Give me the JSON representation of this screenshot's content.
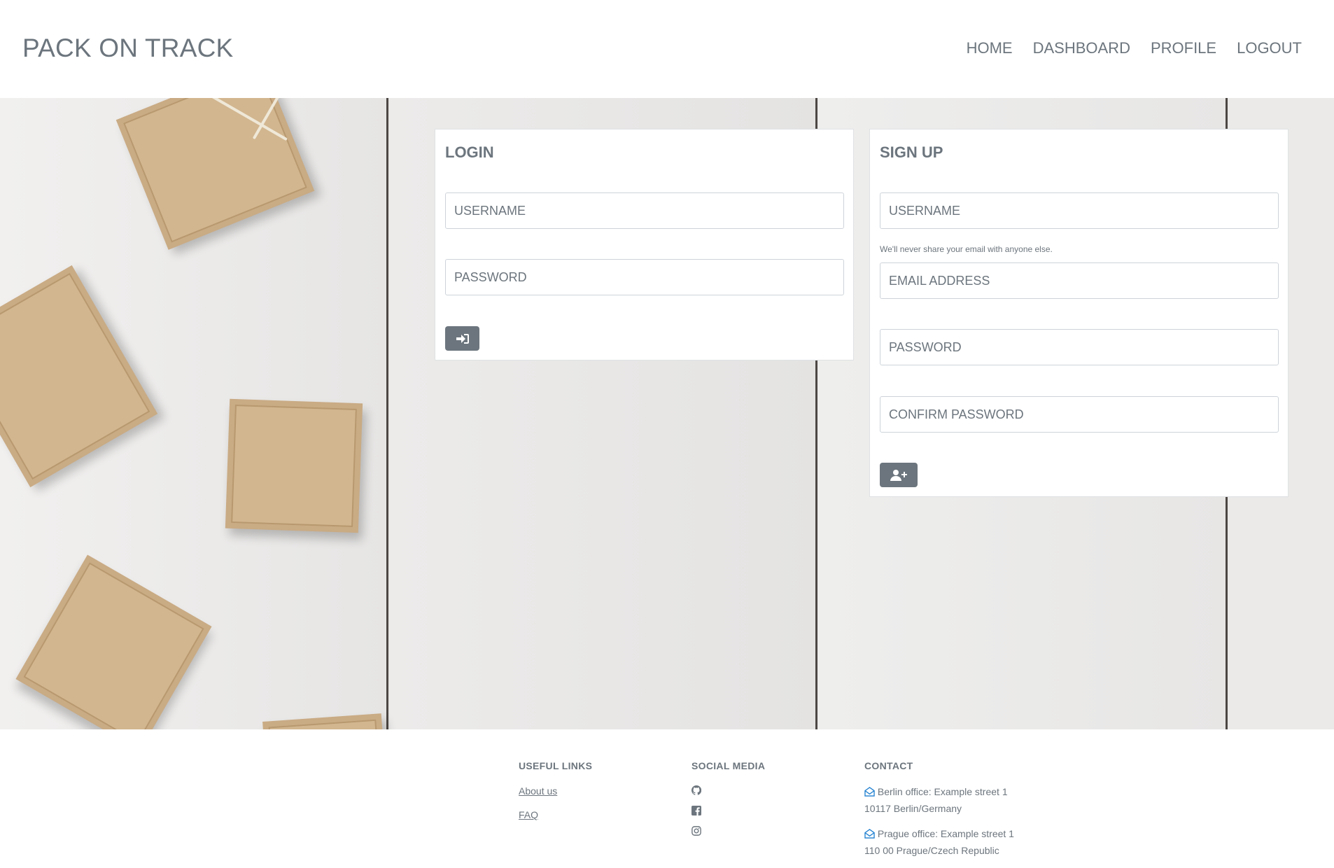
{
  "header": {
    "brand": "PACK ON TRACK",
    "nav": [
      "HOME",
      "DASHBOARD",
      "PROFILE",
      "LOGOUT"
    ]
  },
  "login": {
    "title": "LOGIN",
    "username_placeholder": "USERNAME",
    "password_placeholder": "PASSWORD",
    "submit_icon": "sign-in-icon"
  },
  "signup": {
    "title": "SIGN UP",
    "username_placeholder": "USERNAME",
    "email_hint": "We'll never share your email with anyone else.",
    "email_placeholder": "EMAIL ADDRESS",
    "password_placeholder": "PASSWORD",
    "confirm_placeholder": "CONFIRM PASSWORD",
    "submit_icon": "user-plus-icon"
  },
  "footer": {
    "useful_links": {
      "heading": "USEFUL LINKS",
      "links": [
        "About us",
        "FAQ"
      ]
    },
    "social_media": {
      "heading": "SOCIAL MEDIA",
      "icons": [
        "github-icon",
        "facebook-icon",
        "instagram-icon"
      ]
    },
    "contact": {
      "heading": "CONTACT",
      "offices": [
        {
          "line1": "Berlin office: Example street 1",
          "line2": "10117 Berlin/Germany"
        },
        {
          "line1": "Prague office: Example street 1",
          "line2": "110 00 Prague/Czech Republic"
        }
      ],
      "accent": "#1e7fd0"
    }
  },
  "colors": {
    "primary_text": "#6c757d",
    "button": "#6c757d"
  }
}
